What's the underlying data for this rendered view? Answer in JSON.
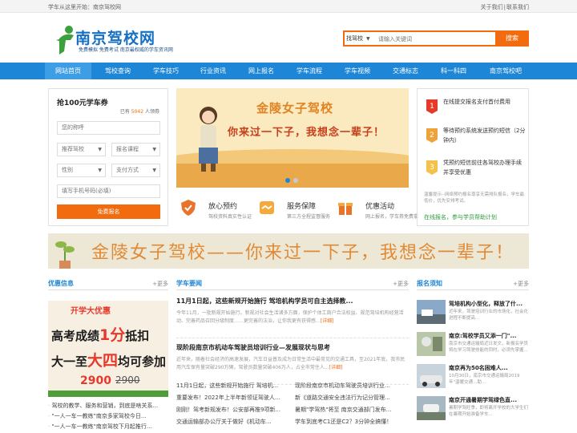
{
  "topbar": {
    "left_text": "学车从这里开始：南京驾校网",
    "about": "关于我们",
    "sep": "|",
    "contact": "联系我们"
  },
  "header": {
    "logo_text": "南京驾校网",
    "slogan": "免费模拟 免费考试  南京最权威的学车资讯网",
    "search_select": "找驾校",
    "search_placeholder": "请输入关键词",
    "search_button": "搜索",
    "brand_color": "#1d86d6",
    "accent_color": "#f26b0f"
  },
  "nav": [
    "网站首页",
    "驾校查询",
    "学车技巧",
    "行业资讯",
    "网上报名",
    "学车流程",
    "学车视频",
    "交通标志",
    "科一科四",
    "南京驾校吧"
  ],
  "signup": {
    "title": "抢100元学车券",
    "count_prefix": "已有",
    "count": "5042",
    "count_suffix": "人领券",
    "name_placeholder": "您的称呼",
    "school_select": "推荐驾校",
    "course_select": "报名课程",
    "gender_select": "性别",
    "pay_select": "支付方式",
    "phone_placeholder": "填写手机号码(必填)",
    "submit": "免费报名"
  },
  "banner": {
    "title": "金陵女子驾校",
    "subtitle": "你来过一下子，我想念一辈子！"
  },
  "features": [
    {
      "title": "放心预约",
      "desc": "驾校资料真实性认证",
      "icon": "shield-icon"
    },
    {
      "title": "服务保障",
      "desc": "第三方全程监督服务",
      "icon": "handshake-icon"
    },
    {
      "title": "优惠活动",
      "desc": "网上报名，学车券免费拿",
      "icon": "gift-icon"
    }
  ],
  "steps": [
    {
      "num": "1",
      "text": "在线提交报名支付首付费用"
    },
    {
      "num": "2",
      "text": "等待预约系统发送预约短信（2分钟内）"
    },
    {
      "num": "3",
      "text": "凭预约短信前往各驾校办理手续并享受优惠"
    }
  ],
  "steps_tip": "温馨提示--网络预约报名尊享无需排队报名，学车最低价，优先安排考试。",
  "steps_online": "在线报名，参与学员帮助计划",
  "ribbon_text": "金陵女子驾校——你来过一下子，我想念一辈子！",
  "sections": {
    "promo_title": "优惠信息",
    "news_title": "学车要闻",
    "guide_title": "报名须知",
    "more": "+更多"
  },
  "promo": {
    "line1": "开学大优惠",
    "line2_pre": "高考成绩",
    "line2_hl": "1分",
    "line2_post": "抵扣",
    "line3_pre": "大一至",
    "line3_hl": "大四",
    "line3_post": "均可参加",
    "price": "2900",
    "old_price": "2900"
  },
  "promo_list": [
    "驾校的教学、服务和营销，到底是啥关系...",
    "\"一人一车一教练\"南京多家驾校今日...",
    "\"一人一车一教练\"南京驾校下月起推行..."
  ],
  "news": [
    {
      "title": "11月1日起，这些新规开始施行 驾培机构学员可自主选择教...",
      "desc": "今年11月，一批新规开始施行。新规对社会生活诸多方面，保护个体工商户合法权益、规范驾培机构经营活动、完善药品召回分级制度……更完善的法治，让你我更有获得感...",
      "link": "[详细]"
    },
    {
      "title": "现阶段南京市机动车驾驶员培训行业—发展现状与思考",
      "desc": "近年来，随着社会经济的高速发展，汽车日益普及成为日常生活中最常见的交通工具，至2021年底，我市民用汽车保有量突破290万辆，驾驶员数量突破406万人，占全市常住人...",
      "link": "[详细]"
    }
  ],
  "news_grid": [
    "11月1日起，这些新规开始施行 驾培机...",
    "现阶段南京市机动车驾驶员培训行业...",
    "重要发布！2022年上半年新领证驾驶人...",
    "新《道路交通安全违法行为记分管理...",
    "刚刚！驾考新规发布！公安部再推9项新...",
    "暑期\"学驾热\"将至 南京交通部门发布...",
    "交通运输部办公厅关于做好《机动车...",
    "学车到底考C1还是C2？3分钟全搞懂！"
  ],
  "guide_list": [
    {
      "title": "驾培机构小型化，释放了什...",
      "desc": "近年来，驾驶培训行业的市场化，社会化进程不断提高..."
    },
    {
      "title": "南京:驾校学员又添一门\"...",
      "desc": "南京市交通运输局近日发文，新报名学员将在学习驾驶技能的同时，必须先掌握..."
    },
    {
      "title": "南京再为50名困难人...",
      "desc": "10月30日，南京市交通运输局2019年\"温暖交通…助…"
    },
    {
      "title": "南京开通暑期学驾绿色直...",
      "desc": "暑期学驾旺季，即将离开学校的大学生们在暑期开始准备学车..."
    }
  ]
}
